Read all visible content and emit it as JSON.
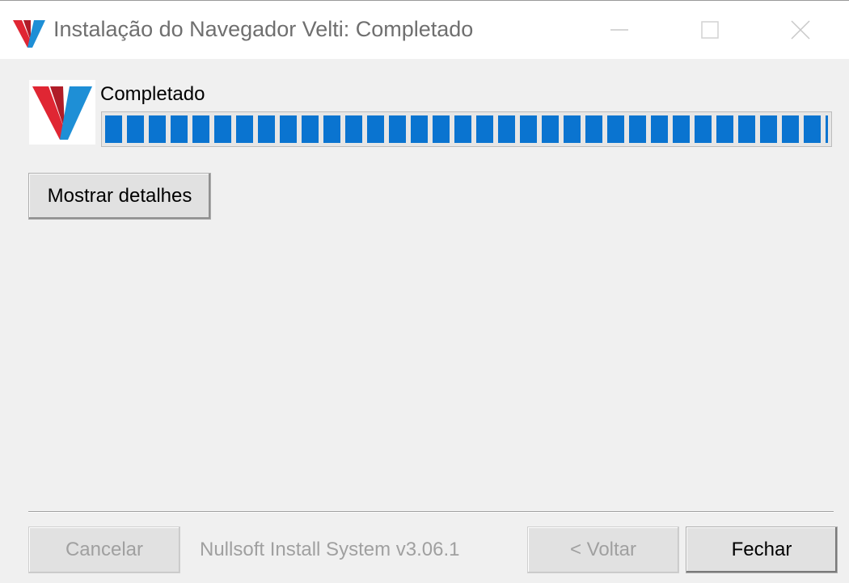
{
  "window": {
    "title": "Instalação do Navegador Velti: Completado",
    "icon": "velti-logo-icon"
  },
  "titlebar_buttons": [
    {
      "name": "minimize",
      "icon": "minimize-icon"
    },
    {
      "name": "maximize",
      "icon": "maximize-icon"
    },
    {
      "name": "close",
      "icon": "close-icon"
    }
  ],
  "header": {
    "logo": "velti-logo",
    "status": "Completado",
    "progress_percent": 100
  },
  "details_button": {
    "label": "Mostrar detalhes"
  },
  "footer": {
    "branding": "Nullsoft Install System v3.06.1",
    "cancel_label": "Cancelar",
    "back_label": "< Voltar",
    "close_label": "Fechar"
  },
  "colors": {
    "logo_red": "#e02633",
    "logo_blue": "#1e8fd6",
    "progress_blue": "#0a74d0",
    "window_bg": "#f0f0f0"
  }
}
